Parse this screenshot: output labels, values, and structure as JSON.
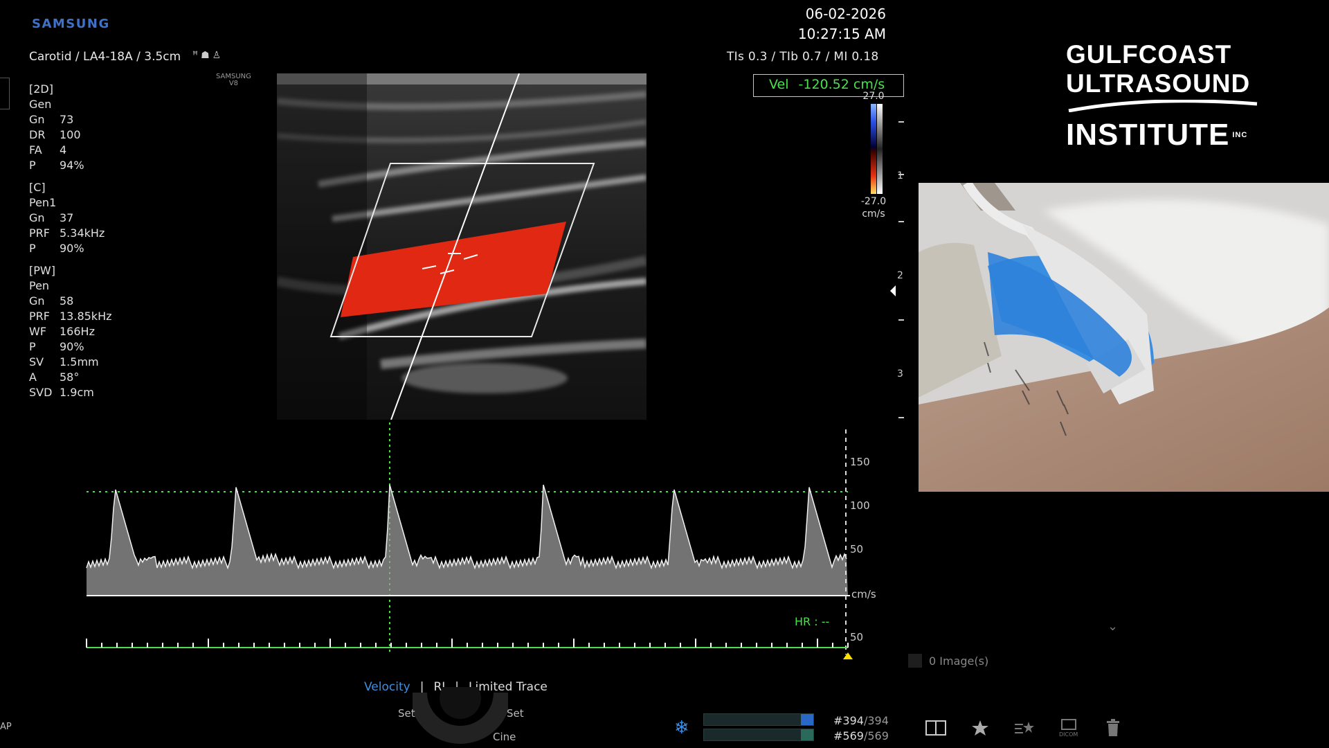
{
  "header": {
    "brand": "SAMSUNG",
    "exam_line": "Carotid / LA4-18A / 3.5cm",
    "device_model_top": "SAMSUNG",
    "device_model_bottom": "V8",
    "date": "06-02-2026",
    "time": "10:27:15 AM",
    "indices": "TIs  0.3 / TIb  0.7 / MI  0.18"
  },
  "velocity_readout": {
    "label": "Vel",
    "value": "-120.52 cm/s"
  },
  "color_scale": {
    "top": "27.0",
    "bottom": "-27.0",
    "unit": "cm/s"
  },
  "depth_scale": [
    "1",
    "2",
    "3"
  ],
  "params": {
    "twod": {
      "title": "[2D]",
      "mode": "Gen",
      "rows": [
        [
          "Gn",
          "73"
        ],
        [
          "DR",
          "100"
        ],
        [
          "FA",
          "4"
        ],
        [
          "P",
          "94%"
        ]
      ]
    },
    "color": {
      "title": "[C]",
      "mode": "Pen1",
      "rows": [
        [
          "Gn",
          "37"
        ],
        [
          "PRF",
          "5.34kHz"
        ],
        [
          "P",
          "90%"
        ]
      ]
    },
    "pw": {
      "title": "[PW]",
      "mode": "Pen",
      "rows": [
        [
          "Gn",
          "58"
        ],
        [
          "PRF",
          "13.85kHz"
        ],
        [
          "WF",
          "166Hz"
        ],
        [
          "P",
          "90%"
        ],
        [
          "SV",
          "1.5mm"
        ],
        [
          "A",
          "58°"
        ],
        [
          "SVD",
          "1.9cm"
        ]
      ]
    }
  },
  "spectral_axis": {
    "labels": [
      "150",
      "100",
      "50",
      "cm/s",
      "50"
    ],
    "hr": "HR : --"
  },
  "trace_menu": {
    "velocity": "Velocity",
    "sep": "|",
    "ri": "RI",
    "limited": "Limited Trace"
  },
  "dial": {
    "set_left": "Set",
    "set_right": "Set",
    "cine": "Cine"
  },
  "cine": {
    "frame1": "#394",
    "total1": "/394",
    "frame2": "#569",
    "total2": "/569",
    "progress1": 1.0,
    "progress2": 1.0
  },
  "images": {
    "count": "0 Image(s)"
  },
  "logo": {
    "line1": "GULFCOAST",
    "line2": "ULTRASOUND",
    "line3": "INSTITUTE",
    "inc": "INC"
  },
  "cap_label": "AP",
  "colors": {
    "doppler_red": "#e02812",
    "overlay_green": "#4ce04c",
    "accent_blue": "#3d8fe0"
  },
  "icons": [
    "shield-icon",
    "snowflake-icon",
    "split-view-icon",
    "star-icon",
    "star-list-icon",
    "dicom-icon",
    "trash-icon"
  ]
}
